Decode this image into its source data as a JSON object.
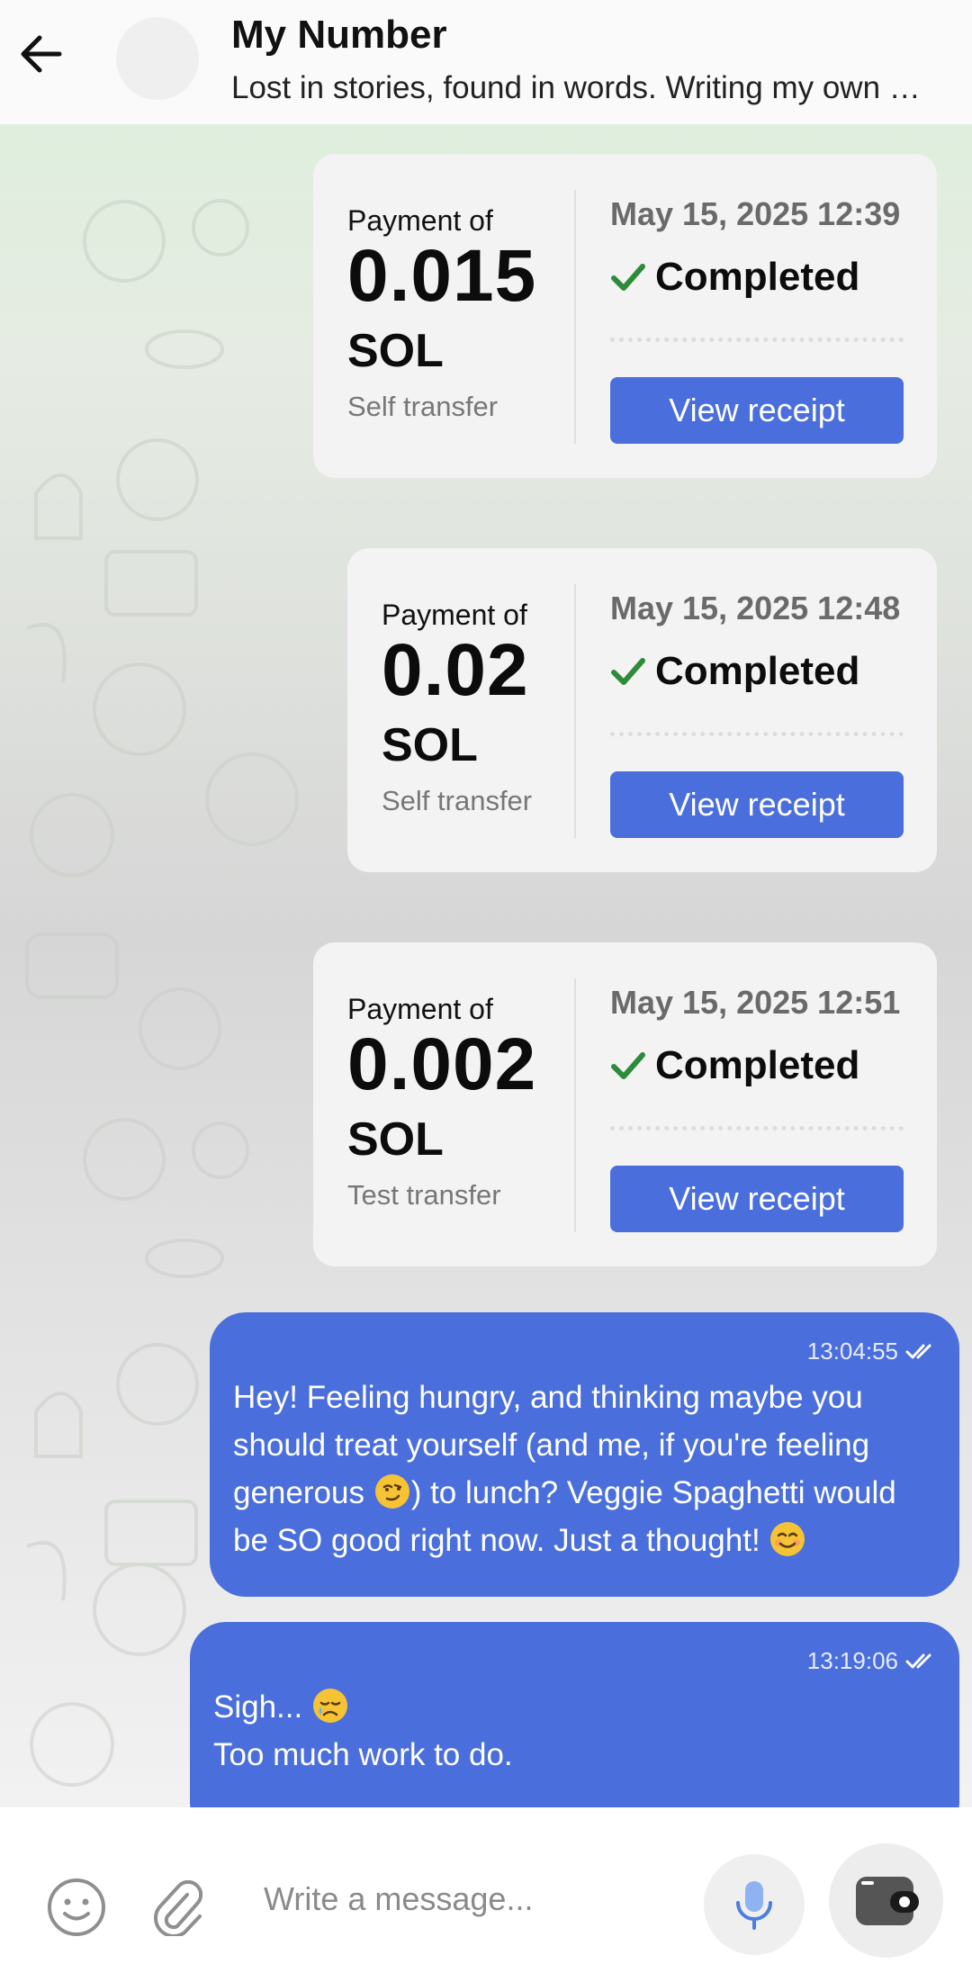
{
  "header": {
    "title": "My Number",
    "subtitle": "Lost in stories, found in words. Writing my own …"
  },
  "payments": [
    {
      "label": "Payment of",
      "amount": "0.015",
      "unit": "SOL",
      "note": "Self transfer",
      "date": "May 15, 2025 12:39",
      "status": "Completed",
      "button": "View receipt"
    },
    {
      "label": "Payment of",
      "amount": "0.02",
      "unit": "SOL",
      "note": "Self transfer",
      "date": "May 15, 2025 12:48",
      "status": "Completed",
      "button": "View receipt"
    },
    {
      "label": "Payment of",
      "amount": "0.002",
      "unit": "SOL",
      "note": "Test transfer",
      "date": "May 15, 2025 12:51",
      "status": "Completed",
      "button": "View receipt"
    }
  ],
  "messages": [
    {
      "time": "13:04:55",
      "lines": [
        "Hey! Feeling hungry, and thinking maybe you",
        "should treat yourself (and me, if you're feeling",
        "generous",
        ") to lunch? Veggie Spaghetti would",
        "be SO good right now. Just a thought!"
      ],
      "emojis": [
        "smirking-face",
        "smiling-face"
      ]
    },
    {
      "time": "13:19:06",
      "lines": [
        "Sigh...",
        "Too much work to do."
      ],
      "emojis": [
        "crying-face"
      ]
    }
  ],
  "composer": {
    "placeholder": "Write a message..."
  },
  "colors": {
    "accent": "#4a6fdd",
    "success": "#2e8b3a",
    "card": "#f3f3f3"
  },
  "icons": [
    "back-arrow-icon",
    "check-icon",
    "double-check-icon",
    "emoji-icon",
    "attach-icon",
    "mic-icon",
    "wallet-icon"
  ]
}
